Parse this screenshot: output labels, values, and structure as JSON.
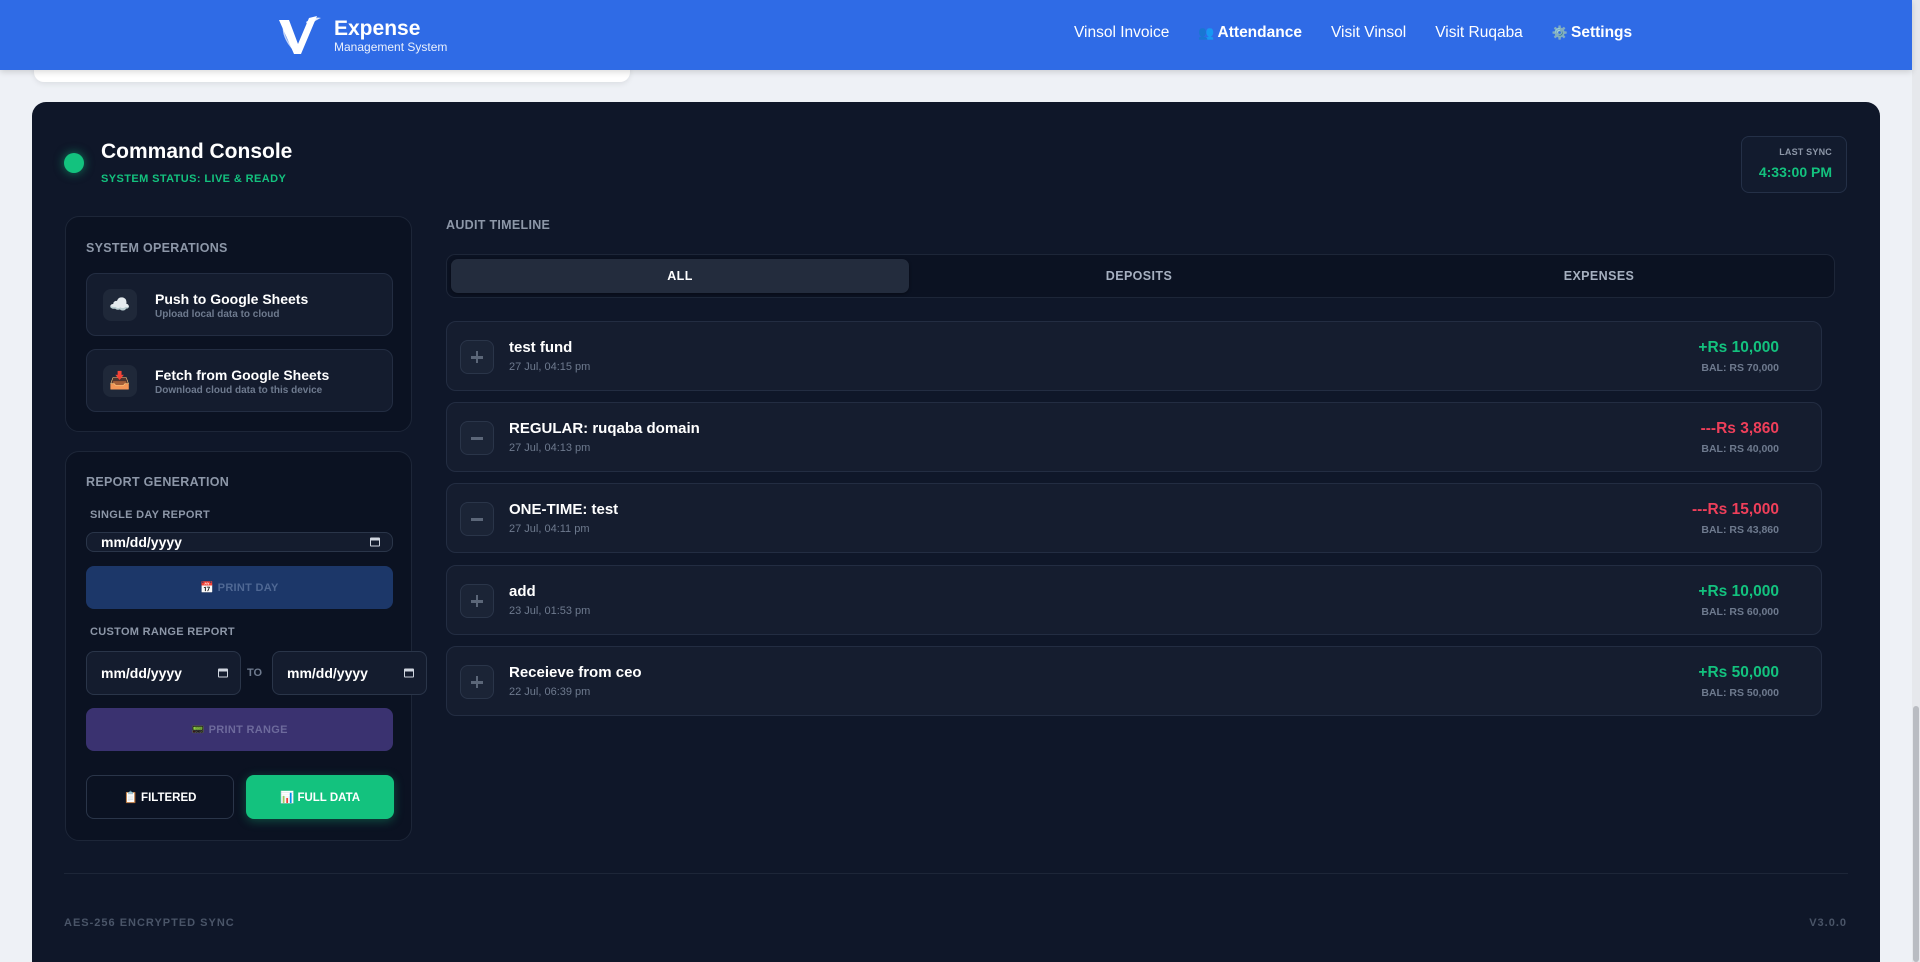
{
  "brand": {
    "title": "Expense",
    "subtitle": "Management System"
  },
  "nav": {
    "invoice": "Vinsol Invoice",
    "attendance": "Attendance",
    "visit_vinsol": "Visit Vinsol",
    "visit_ruqaba": "Visit Ruqaba",
    "settings": "Settings"
  },
  "console": {
    "title": "Command Console",
    "status": "SYSTEM STATUS: LIVE & READY",
    "sync_label": "LAST SYNC",
    "sync_time": "4:33:00 PM"
  },
  "operations": {
    "title": "SYSTEM OPERATIONS",
    "push": {
      "title": "Push to Google Sheets",
      "subtitle": "Upload local data to cloud",
      "icon": "cloud-icon"
    },
    "fetch": {
      "title": "Fetch from Google Sheets",
      "subtitle": "Download cloud data to this device",
      "icon": "inbox-tray-icon"
    }
  },
  "report": {
    "title": "REPORT GENERATION",
    "single_label": "SINGLE DAY REPORT",
    "single_placeholder": "mm/dd/yyyy",
    "print_day": "📅 PRINT DAY",
    "range_label": "CUSTOM RANGE REPORT",
    "range_from_placeholder": "mm/dd/yyyy",
    "to": "TO",
    "range_to_placeholder": "mm/dd/yyyy",
    "print_range": "📟 PRINT RANGE",
    "filtered": "📋 FILTERED",
    "full_data": "📊 FULL DATA"
  },
  "audit": {
    "title": "AUDIT TIMELINE",
    "tabs": [
      "ALL",
      "DEPOSITS",
      "EXPENSES"
    ],
    "active_tab": "ALL",
    "transactions": [
      {
        "type": "deposit",
        "title": "test fund",
        "date": "27 Jul, 04:15 pm",
        "amount": "+Rs 10,000",
        "balance": "BAL: RS 70,000"
      },
      {
        "type": "expense",
        "title": "REGULAR: ruqaba domain",
        "date": "27 Jul, 04:13 pm",
        "amount": "---Rs 3,860",
        "balance": "BAL: RS 40,000"
      },
      {
        "type": "expense",
        "title": "ONE-TIME: test",
        "date": "27 Jul, 04:11 pm",
        "amount": "---Rs 15,000",
        "balance": "BAL: RS 43,860"
      },
      {
        "type": "deposit",
        "title": "add",
        "date": "23 Jul, 01:53 pm",
        "amount": "+Rs 10,000",
        "balance": "BAL: RS 60,000"
      },
      {
        "type": "deposit",
        "title": "Receieve from ceo",
        "date": "22 Jul, 06:39 pm",
        "amount": "+Rs 50,000",
        "balance": "BAL: RS 50,000"
      }
    ]
  },
  "footer": {
    "left": "AES-256 ENCRYPTED SYNC",
    "right": "V3.0.0"
  },
  "colors": {
    "nav_bg": "#2f6be6",
    "console_bg": "#0f1729",
    "accent_green": "#13c27e",
    "accent_red": "#ef3f5a"
  }
}
